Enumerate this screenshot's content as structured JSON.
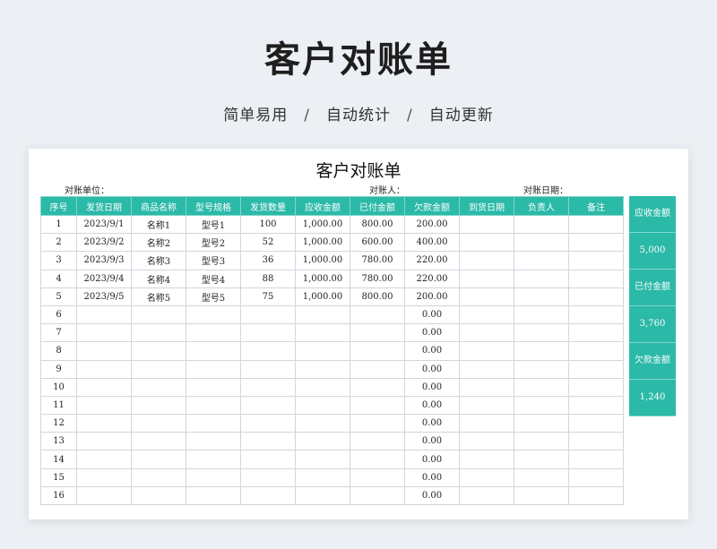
{
  "page": {
    "title": "客户对账单",
    "subtitle": [
      "简单易用",
      "自动统计",
      "自动更新"
    ],
    "separator": "/"
  },
  "sheet": {
    "title": "客户对账单",
    "meta": {
      "unit_label": "对账单位：",
      "person_label": "对账人：",
      "date_label": "对账日期："
    },
    "columns": [
      "序号",
      "发货日期",
      "商品名称",
      "型号规格",
      "发货数量",
      "应收金额",
      "已付金额",
      "欠款金额",
      "到货日期",
      "负责人",
      "备注"
    ],
    "rows": [
      [
        "1",
        "2023/9/1",
        "名称1",
        "型号1",
        "100",
        "1,000.00",
        "800.00",
        "200.00",
        "",
        "",
        ""
      ],
      [
        "2",
        "2023/9/2",
        "名称2",
        "型号2",
        "52",
        "1,000.00",
        "600.00",
        "400.00",
        "",
        "",
        ""
      ],
      [
        "3",
        "2023/9/3",
        "名称3",
        "型号3",
        "36",
        "1,000.00",
        "780.00",
        "220.00",
        "",
        "",
        ""
      ],
      [
        "4",
        "2023/9/4",
        "名称4",
        "型号4",
        "88",
        "1,000.00",
        "780.00",
        "220.00",
        "",
        "",
        ""
      ],
      [
        "5",
        "2023/9/5",
        "名称5",
        "型号5",
        "75",
        "1,000.00",
        "800.00",
        "200.00",
        "",
        "",
        ""
      ],
      [
        "6",
        "",
        "",
        "",
        "",
        "",
        "",
        "0.00",
        "",
        "",
        ""
      ],
      [
        "7",
        "",
        "",
        "",
        "",
        "",
        "",
        "0.00",
        "",
        "",
        ""
      ],
      [
        "8",
        "",
        "",
        "",
        "",
        "",
        "",
        "0.00",
        "",
        "",
        ""
      ],
      [
        "9",
        "",
        "",
        "",
        "",
        "",
        "",
        "0.00",
        "",
        "",
        ""
      ],
      [
        "10",
        "",
        "",
        "",
        "",
        "",
        "",
        "0.00",
        "",
        "",
        ""
      ],
      [
        "11",
        "",
        "",
        "",
        "",
        "",
        "",
        "0.00",
        "",
        "",
        ""
      ],
      [
        "12",
        "",
        "",
        "",
        "",
        "",
        "",
        "0.00",
        "",
        "",
        ""
      ],
      [
        "13",
        "",
        "",
        "",
        "",
        "",
        "",
        "0.00",
        "",
        "",
        ""
      ],
      [
        "14",
        "",
        "",
        "",
        "",
        "",
        "",
        "0.00",
        "",
        "",
        ""
      ],
      [
        "15",
        "",
        "",
        "",
        "",
        "",
        "",
        "0.00",
        "",
        "",
        ""
      ],
      [
        "16",
        "",
        "",
        "",
        "",
        "",
        "",
        "0.00",
        "",
        "",
        ""
      ]
    ],
    "summary": {
      "receivable_label": "应收金额",
      "receivable_value": "5,000",
      "paid_label": "已付金额",
      "paid_value": "3,760",
      "owed_label": "欠款金额",
      "owed_value": "1,240"
    }
  },
  "colors": {
    "accent": "#2bb9a8",
    "page_bg": "#eceff3"
  }
}
